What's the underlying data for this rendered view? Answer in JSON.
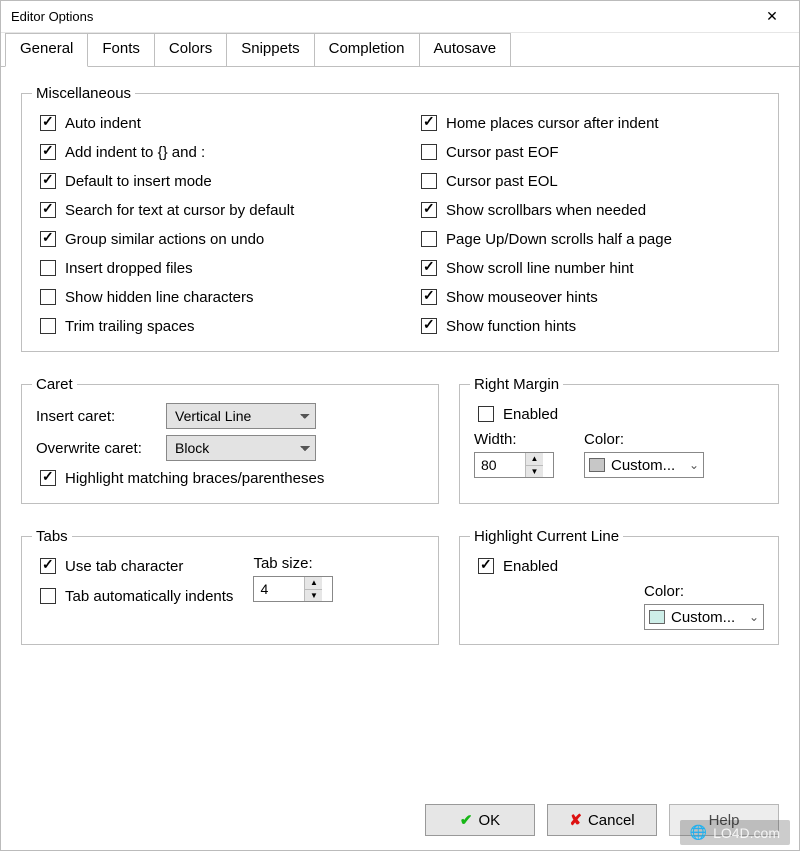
{
  "window": {
    "title": "Editor Options"
  },
  "tabs": {
    "items": [
      "General",
      "Fonts",
      "Colors",
      "Snippets",
      "Completion",
      "Autosave"
    ],
    "active": 0
  },
  "misc": {
    "legend": "Miscellaneous",
    "left": [
      {
        "label": "Auto indent",
        "checked": true
      },
      {
        "label": "Add indent to {} and :",
        "checked": true
      },
      {
        "label": "Default to insert mode",
        "checked": true
      },
      {
        "label": "Search for text at cursor by default",
        "checked": true
      },
      {
        "label": "Group similar actions on undo",
        "checked": true
      },
      {
        "label": "Insert dropped files",
        "checked": false
      },
      {
        "label": "Show hidden line characters",
        "checked": false
      },
      {
        "label": "Trim trailing spaces",
        "checked": false
      }
    ],
    "right": [
      {
        "label": "Home places cursor after indent",
        "checked": true
      },
      {
        "label": "Cursor past EOF",
        "checked": false
      },
      {
        "label": "Cursor past EOL",
        "checked": false
      },
      {
        "label": "Show scrollbars when needed",
        "checked": true
      },
      {
        "label": "Page Up/Down scrolls half a page",
        "checked": false
      },
      {
        "label": "Show scroll line number hint",
        "checked": true
      },
      {
        "label": "Show mouseover hints",
        "checked": true
      },
      {
        "label": "Show function hints",
        "checked": true
      }
    ]
  },
  "caret": {
    "legend": "Caret",
    "insert_label": "Insert caret:",
    "insert_value": "Vertical Line",
    "overwrite_label": "Overwrite caret:",
    "overwrite_value": "Block",
    "highlight_label": "Highlight matching braces/parentheses",
    "highlight_checked": true
  },
  "right_margin": {
    "legend": "Right Margin",
    "enabled_label": "Enabled",
    "enabled_checked": false,
    "width_label": "Width:",
    "width_value": "80",
    "color_label": "Color:",
    "color_value": "Custom...",
    "color_swatch": "#c7c7c7"
  },
  "tabs_group": {
    "legend": "Tabs",
    "use_tab_label": "Use tab character",
    "use_tab_checked": true,
    "auto_indent_label": "Tab automatically indents",
    "auto_indent_checked": false,
    "tab_size_label": "Tab size:",
    "tab_size_value": "4"
  },
  "highlight_line": {
    "legend": "Highlight Current Line",
    "enabled_label": "Enabled",
    "enabled_checked": true,
    "color_label": "Color:",
    "color_value": "Custom...",
    "color_swatch": "#cdeee8"
  },
  "buttons": {
    "ok": "OK",
    "cancel": "Cancel",
    "help": "Help"
  },
  "watermark": "LO4D.com"
}
